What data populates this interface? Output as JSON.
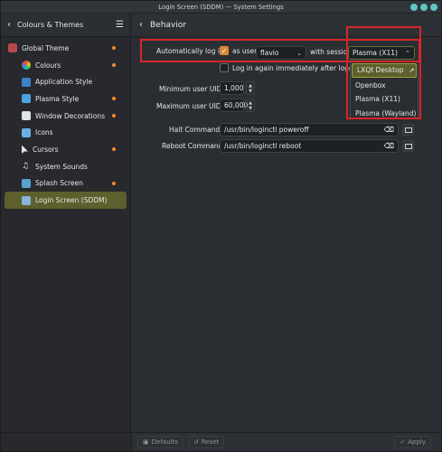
{
  "window": {
    "title": "Login Screen (SDDM) — System Settings"
  },
  "sidebar": {
    "back_label": "Colours & Themes",
    "items": [
      {
        "label": "Global Theme",
        "dot": true
      },
      {
        "label": "Colours",
        "dot": true
      },
      {
        "label": "Application Style",
        "dot": false
      },
      {
        "label": "Plasma Style",
        "dot": true
      },
      {
        "label": "Window Decorations",
        "dot": true
      },
      {
        "label": "Icons",
        "dot": false
      },
      {
        "label": "Cursors",
        "dot": true
      },
      {
        "label": "System Sounds",
        "dot": false
      },
      {
        "label": "Splash Screen",
        "dot": true
      },
      {
        "label": "Login Screen (SDDM)",
        "dot": false
      }
    ]
  },
  "main": {
    "title": "Behavior",
    "autologin_label": "Automatically log in:",
    "as_user_label": "as user:",
    "user_value": "flavio",
    "with_session_label": "with session",
    "session_value": "Plasma (X11)",
    "relogin_label": "Log in again immediately after logging off",
    "min_uid_label": "Minimum user UID:",
    "min_uid_value": "1,000",
    "max_uid_label": "Maximum user UID:",
    "max_uid_value": "60,000",
    "halt_label": "Halt Command:",
    "halt_value": "/usr/bin/loginctl poweroff",
    "reboot_label": "Reboot Command:",
    "reboot_value": "/usr/bin/loginctl reboot",
    "session_options": [
      "LXQt Desktop",
      "Openbox",
      "Plasma (X11)",
      "Plasma (Wayland)"
    ]
  },
  "footer": {
    "defaults": "Defaults",
    "reset": "Reset",
    "apply": "Apply"
  }
}
